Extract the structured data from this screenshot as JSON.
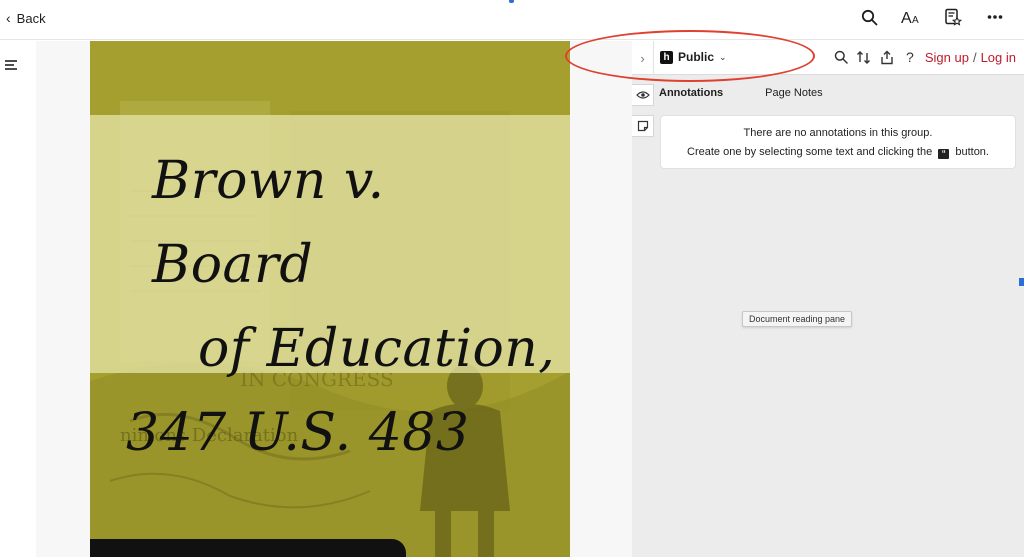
{
  "topbar": {
    "back_label": "Back",
    "icons": [
      "search-icon",
      "text-size-icon",
      "reading-list-icon",
      "more-icon"
    ]
  },
  "cover": {
    "title_line1": "Brown v. Board",
    "title_line2": "of Education,",
    "title_line3": "347 U.S. 483",
    "background_color": "#a59f2f",
    "band_color": "#e4e2a5"
  },
  "sidebar": {
    "group_name": "Public",
    "sign_up": "Sign up",
    "separator": "/",
    "log_in": "Log in",
    "tabs": [
      {
        "label": "Annotations",
        "active": true
      },
      {
        "label": "Page Notes",
        "active": false
      }
    ],
    "empty_line1": "There are no annotations in this group.",
    "empty_line2_pre": "Create one by selecting some text and clicking the",
    "empty_line2_post": "button.",
    "accent_color": "#bd1c2b"
  },
  "tooltip": {
    "text": "Document reading pane"
  }
}
